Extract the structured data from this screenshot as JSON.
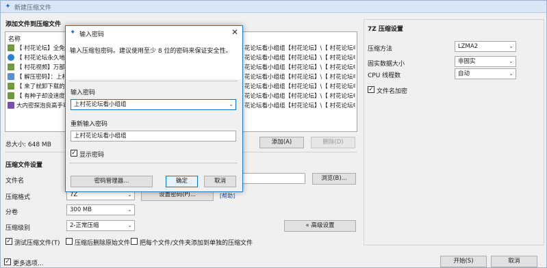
{
  "window": {
    "title": "新建压缩文件"
  },
  "add_files": {
    "section_title": "添加文件到压缩文件",
    "list_header": "名称",
    "rows": [
      {
        "name": "【 村花论坛】全免费",
        "path": "花论坛看小组组【村花论坛】\\【 村花论坛申请和资源说明】\\【 村花论坛",
        "icon_color": "#6e9a3c"
      },
      {
        "name": "【 村花论坛永久地址",
        "path": "花论坛看小组组【村花论坛】\\【 村花论坛申请和资源说明】\\【 村花论坛",
        "icon_color": "#2a7fd4"
      },
      {
        "name": "【 村花视频】万部种",
        "path": "花论坛看小组组【村花论坛】\\【 村花论坛申请和资源说明】\\【 村花视",
        "icon_color": "#6e9a3c"
      },
      {
        "name": "【 解压密码】：上村",
        "path": "花论坛看小组组【村花论坛】\\【 村花论坛申请和资源说明】\\【 解压密",
        "icon_color": "#5a8fd8"
      },
      {
        "name": "【 来了就卸下载的你",
        "path": "花论坛看小组组【村花论坛】\\【 村花论坛申请和资源说明】\\【 来了就",
        "icon_color": "#6e9a3c"
      },
      {
        "name": "【 有种子却没速度？",
        "path": "花论坛看小组组【村花论坛】\\【 村花论坛申请和资源说明】\\【 有种子",
        "icon_color": "#6e9a3c"
      },
      {
        "name": "大内密探泡良高手审",
        "path": "花论坛看小组组【村花论坛】\\【 村花论坛申请和资源说明】\\大内密探",
        "icon_color": "#7a4db3"
      }
    ],
    "total_size_label": "总大小: 648 MB",
    "add_button": "添加(A)",
    "delete_button": "删除(D)"
  },
  "archive_settings": {
    "section_title": "压缩文件设置",
    "filename_label": "文件名",
    "filename_value": "",
    "browse_button": "浏览(B)...",
    "format_label": "压缩格式",
    "format_value": "7Z",
    "set_password_button": "设置密码(P)...",
    "password_hint_link": "[帮助]",
    "split_label": "分卷",
    "split_value": "300 MB",
    "level_label": "压缩级别",
    "level_value": "2-正常压缩",
    "advanced_button": "« 高级设置",
    "test_label": "测试压缩文件(T)",
    "delete_source_label": "压缩后删除原始文件",
    "each_file_label": "把每个文件/文件夹添加到单独的压缩文件"
  },
  "seven_z": {
    "section_title": "7Z 压缩设置",
    "method_label": "压缩方法",
    "method_value": "LZMA2",
    "dict_label": "固实数据大小",
    "dict_value": "非固实",
    "cpu_label": "CPU 线程数",
    "cpu_value": "自动",
    "encrypt_names_label": "文件名加密"
  },
  "footer": {
    "more_options_label": "更多选项...",
    "start_button": "开始(S)",
    "cancel_button": "取消"
  },
  "dialog": {
    "title": "输入密码",
    "description": "输入压缩包密码。建议使用至少 8 位的密码来保证安全性。",
    "password_label": "输入密码",
    "password_value": "上村花论坛看小组组",
    "confirm_label": "重新输入密码",
    "confirm_value": "上村花论坛看小组组",
    "show_password_label": "显示密码",
    "manager_button": "密码管理器...",
    "ok_button": "确定",
    "cancel_button": "取消"
  },
  "colors": {
    "accent": "#0078d7",
    "titlebar_bg": "#d9e6f5",
    "window_bg": "#f0f0f0"
  }
}
